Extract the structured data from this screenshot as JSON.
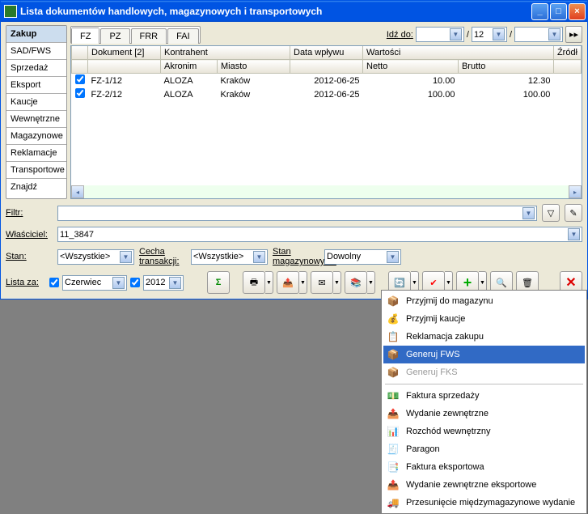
{
  "title": "Lista dokumentów handlowych, magazynowych i transportowych",
  "sidebar": {
    "items": [
      {
        "label": "Zakup"
      },
      {
        "label": "SAD/FWS"
      },
      {
        "label": "Sprzedaż"
      },
      {
        "label": "Eksport"
      },
      {
        "label": "Kaucje"
      },
      {
        "label": "Wewnętrzne"
      },
      {
        "label": "Magazynowe"
      },
      {
        "label": "Reklamacje"
      },
      {
        "label": "Transportowe"
      },
      {
        "label": "Znajdź"
      }
    ]
  },
  "tabs": [
    {
      "label": "FZ"
    },
    {
      "label": "PZ"
    },
    {
      "label": "FRR"
    },
    {
      "label": "FAI"
    }
  ],
  "idz": {
    "label": "Idź do:",
    "sep": "/",
    "val2": "12"
  },
  "grid": {
    "head1": {
      "doc": "Dokument [2]",
      "kon": "Kontrahent",
      "data": "Data wpływu",
      "wart": "Wartości",
      "zrod": "Źródł"
    },
    "head2": {
      "akr": "Akronim",
      "miasto": "Miasto",
      "netto": "Netto",
      "brutto": "Brutto"
    },
    "rows": [
      {
        "doc": "FZ-1/12",
        "akr": "ALOZA",
        "miasto": "Kraków",
        "data": "2012-06-25",
        "netto": "10.00",
        "brutto": "12.30"
      },
      {
        "doc": "FZ-2/12",
        "akr": "ALOZA",
        "miasto": "Kraków",
        "data": "2012-06-25",
        "netto": "100.00",
        "brutto": "100.00"
      }
    ]
  },
  "filters": {
    "filtr": "Filtr:",
    "wlasc": "Właściciel:",
    "wlasc_val": "11_3847",
    "stan": "Stan:",
    "stan_val": "<Wszystkie>",
    "cecha": "Cecha transakcji:",
    "cecha_val": "<Wszystkie>",
    "stanmag": "Stan magazynowych:",
    "stanmag_val": "Dowolny",
    "lista": "Lista za:",
    "month": "Czerwiec",
    "year": "2012"
  },
  "menu": {
    "items": [
      {
        "icon": "📦",
        "label": "Przyjmij do magazynu"
      },
      {
        "icon": "💰",
        "label": "Przyjmij kaucje"
      },
      {
        "icon": "📋",
        "label": "Reklamacja zakupu"
      },
      {
        "icon": "📦",
        "label": "Generuj FWS",
        "sel": true
      },
      {
        "icon": "📦",
        "label": "Generuj FKS",
        "disabled": true
      },
      {
        "sep": true
      },
      {
        "icon": "💵",
        "label": "Faktura sprzedaży"
      },
      {
        "icon": "📤",
        "label": "Wydanie zewnętrzne"
      },
      {
        "icon": "📊",
        "label": "Rozchód wewnętrzny"
      },
      {
        "icon": "🧾",
        "label": "Paragon"
      },
      {
        "icon": "📑",
        "label": "Faktura eksportowa"
      },
      {
        "icon": "📤",
        "label": "Wydanie zewnętrzne eksportowe"
      },
      {
        "icon": "🚚",
        "label": "Przesunięcie międzymagazynowe wydanie"
      }
    ]
  }
}
